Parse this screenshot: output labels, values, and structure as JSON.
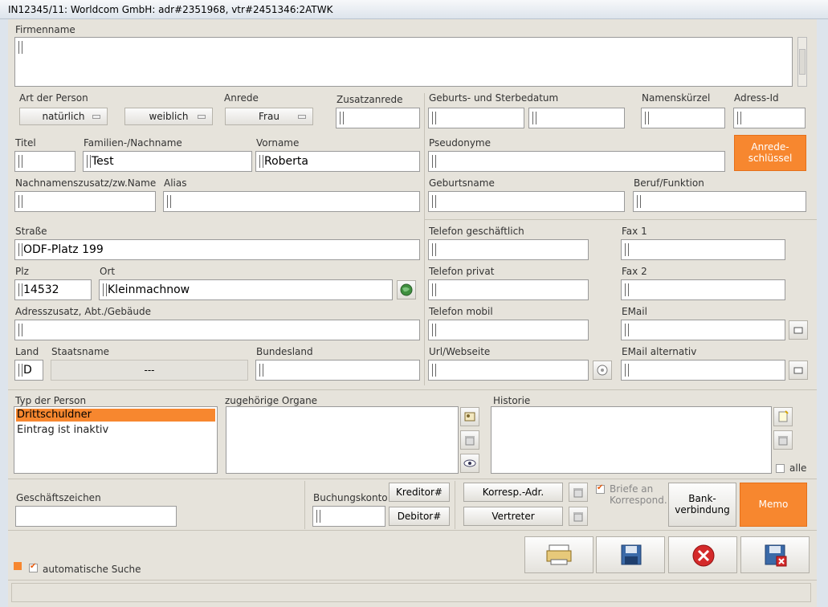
{
  "window": {
    "title": "IN12345/11: Worldcom GmbH: adr#2351968, vtr#2451346:2ATWK"
  },
  "labels": {
    "firmenname": "Firmenname",
    "art_der_person": "Art der Person",
    "anrede": "Anrede",
    "zusatzanrede": "Zusatzanrede",
    "geburts_sterbe": "Geburts- und Sterbedatum",
    "namenskuerzel": "Namenskürzel",
    "adress_id": "Adress-Id",
    "titel": "Titel",
    "familienname": "Familien-/Nachname",
    "vorname": "Vorname",
    "pseudonyme": "Pseudonyme",
    "nachnamenszusatz": "Nachnamenszusatz/zw.Name",
    "alias": "Alias",
    "geburtsname": "Geburtsname",
    "beruf": "Beruf/Funktion",
    "strasse": "Straße",
    "tel_geschaeftlich": "Telefon geschäftlich",
    "fax1": "Fax 1",
    "plz": "Plz",
    "ort": "Ort",
    "tel_privat": "Telefon privat",
    "fax2": "Fax 2",
    "adresszusatz": "Adresszusatz, Abt./Gebäude",
    "tel_mobil": "Telefon mobil",
    "email": "EMail",
    "land": "Land",
    "staatsname": "Staatsname",
    "bundesland": "Bundesland",
    "url": "Url/Webseite",
    "email_alt": "EMail alternativ",
    "typ_der_person": "Typ der Person",
    "organe": "zugehörige Organe",
    "historie": "Historie",
    "alle": "alle",
    "geschaeftszeichen": "Geschäftszeichen",
    "buchungskonto": "Buchungskonto",
    "briefe": "Briefe an Korrespond.",
    "auto_suche": "automatische Suche"
  },
  "values": {
    "art_der_person": "natürlich",
    "geschlecht": "weiblich",
    "anrede": "Frau",
    "familienname": "Test",
    "vorname": "Roberta",
    "strasse": "ODF-Platz 199",
    "plz": "14532",
    "ort": "Kleinmachnow",
    "land": "D",
    "staatsname": "---"
  },
  "typ_items": [
    "Drittschuldner",
    "Eintrag ist inaktiv"
  ],
  "buttons": {
    "anrede_schluessel": "Anrede-schlüssel",
    "kreditor": "Kreditor#",
    "debitor": "Debitor#",
    "korresp": "Korresp.-Adr.",
    "vertreter": "Vertreter",
    "bank": "Bank-verbindung",
    "memo": "Memo"
  },
  "colors": {
    "accent": "#f7872f",
    "selection": "#f7872f"
  }
}
